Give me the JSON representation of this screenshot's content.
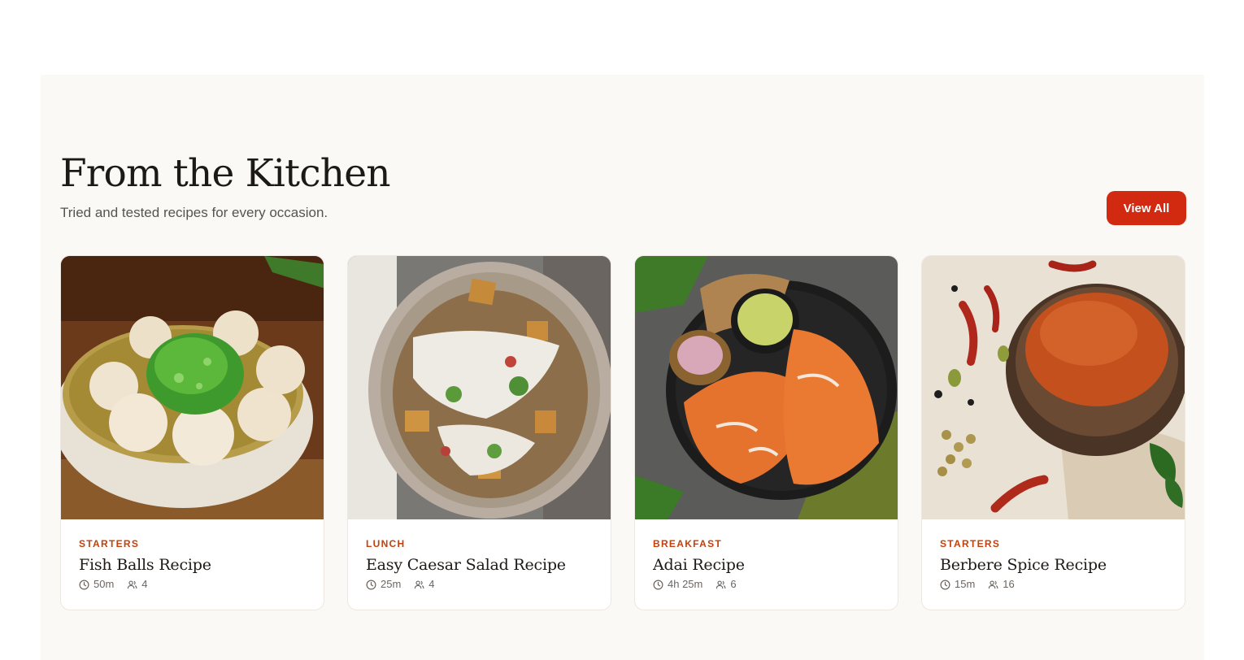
{
  "section": {
    "title": "From the Kitchen",
    "subtitle": "Tried and tested recipes for every occasion.",
    "view_all_label": "View All"
  },
  "icons": {
    "time": "clock-icon",
    "servings": "users-icon"
  },
  "colors": {
    "accent": "#d12a10",
    "category": "#c2410c",
    "section_background": "#fbf9f6"
  },
  "recipes": [
    {
      "category": "STARTERS",
      "title": "Fish Balls Recipe",
      "time": "50m",
      "servings": "4"
    },
    {
      "category": "LUNCH",
      "title": "Easy Caesar Salad Recipe",
      "time": "25m",
      "servings": "4"
    },
    {
      "category": "BREAKFAST",
      "title": "Adai Recipe",
      "time": "4h 25m",
      "servings": "6"
    },
    {
      "category": "STARTERS",
      "title": "Berbere Spice Recipe",
      "time": "15m",
      "servings": "16"
    }
  ]
}
